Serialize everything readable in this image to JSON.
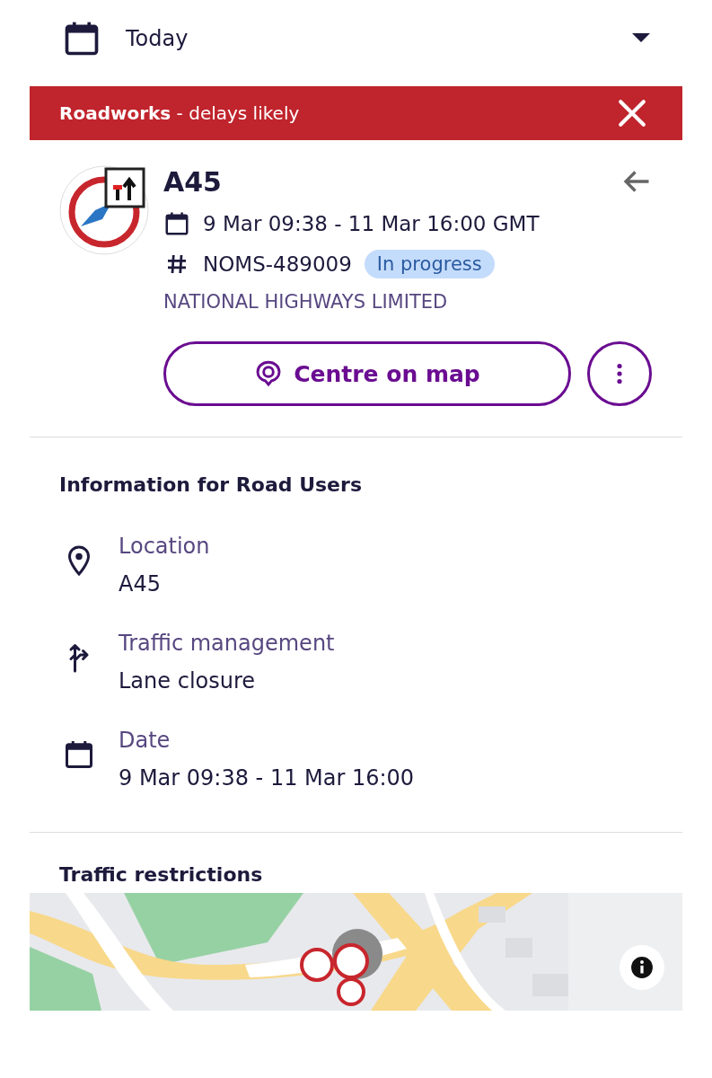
{
  "date_selector": {
    "label": "Today"
  },
  "alert": {
    "text": "**Roadworks** - delays likely"
  },
  "works": {
    "title": "A45",
    "dates": "9 Mar 09:38 - 11 Mar 16:00 GMT",
    "reference": "NOMS-489009",
    "status": "In progress",
    "organisation": "NATIONAL HIGHWAYS LIMITED",
    "action": "Centre on map"
  },
  "road_user_info": {
    "heading": "Information for Road Users",
    "items": [
      {
        "kind": "location",
        "label": "Location",
        "value": "A45"
      },
      {
        "kind": "traffic",
        "label": "Traffic management",
        "value": "Lane closure"
      },
      {
        "kind": "date",
        "label": "Date",
        "value": "9 Mar 09:38 - 11 Mar 16:00"
      }
    ]
  },
  "restrictions": {
    "heading": "Traffic restrictions"
  }
}
